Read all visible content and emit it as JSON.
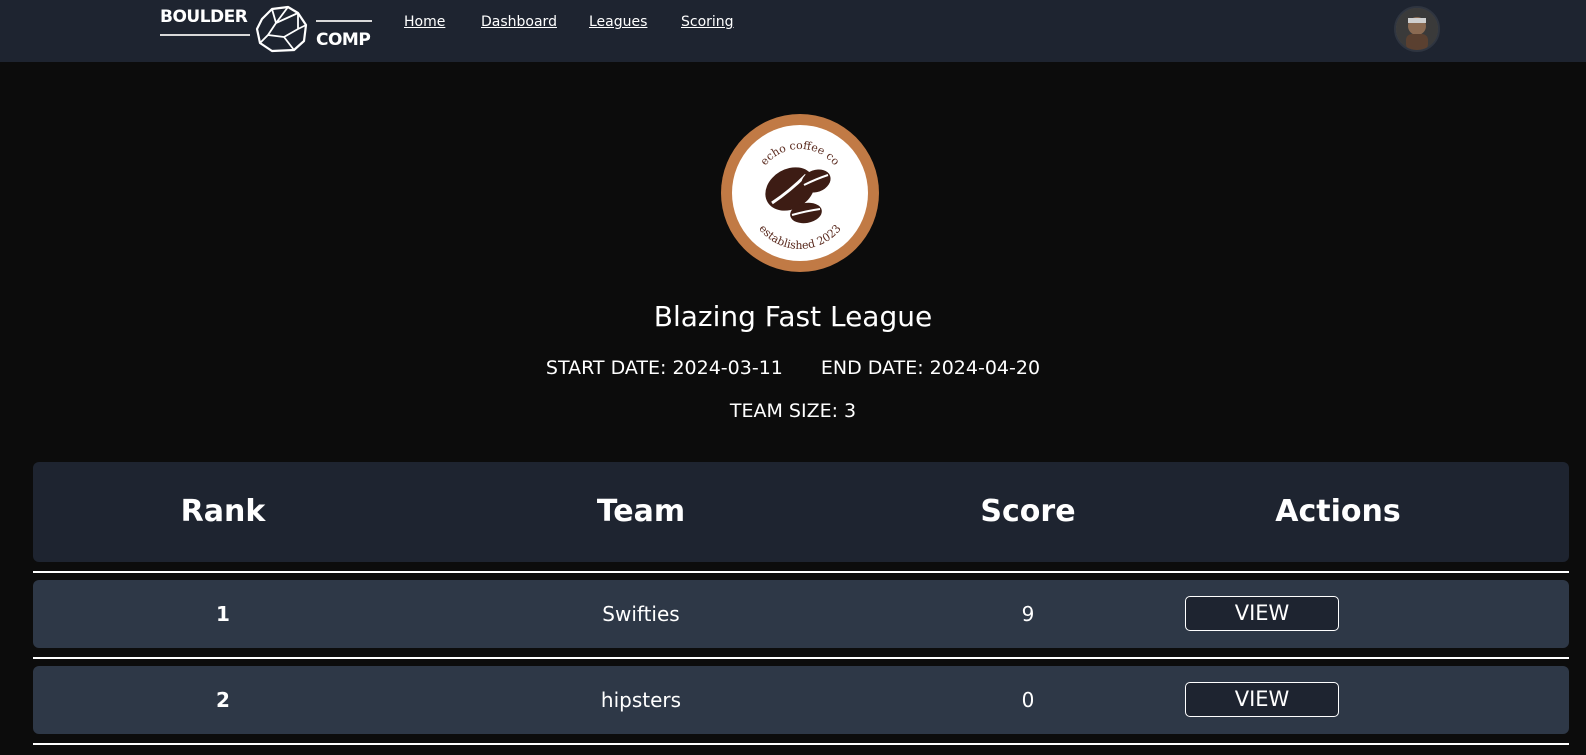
{
  "brand": {
    "word1": "BOULDER",
    "word2": "COMP"
  },
  "nav": {
    "items": [
      {
        "label": "Home"
      },
      {
        "label": "Dashboard"
      },
      {
        "label": "Leagues"
      },
      {
        "label": "Scoring"
      }
    ]
  },
  "league": {
    "logo_text_top": "echo coffee co",
    "logo_text_bottom": "established 2023",
    "title": "Blazing Fast League",
    "start_date_label": "START DATE: 2024-03-11",
    "end_date_label": "END DATE: 2024-04-20",
    "team_size_label": "TEAM SIZE: 3"
  },
  "table": {
    "headers": {
      "rank": "Rank",
      "team": "Team",
      "score": "Score",
      "actions": "Actions"
    },
    "rows": [
      {
        "rank": "1",
        "team": "Swifties",
        "score": "9",
        "action": "VIEW"
      },
      {
        "rank": "2",
        "team": "hipsters",
        "score": "0",
        "action": "VIEW"
      }
    ]
  },
  "colors": {
    "page_bg": "#0c0c0c",
    "navbar_bg": "#1e2430",
    "row_bg": "#2e3847",
    "logo_ring": "#c17a45",
    "bean": "#3d1c14"
  }
}
